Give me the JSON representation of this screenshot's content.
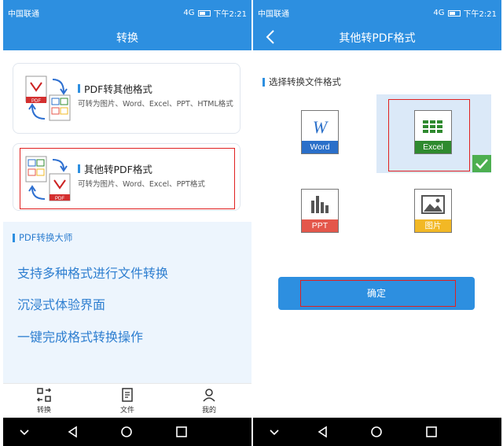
{
  "status": {
    "carrier": "中国联通",
    "network": "4G",
    "time": "下午2:21"
  },
  "convert": {
    "title": "转换",
    "cards": [
      {
        "title": "PDF转其他格式",
        "desc": "可转为图片、Word、Excel、PPT、HTML格式"
      },
      {
        "title": "其他转PDF格式",
        "desc": "可转为图片、Word、Excel、PPT格式"
      }
    ],
    "promo": {
      "label": "PDF转换大师",
      "lines": [
        "支持多种格式进行文件转换",
        "沉浸式体验界面",
        "一键完成格式转换操作"
      ]
    },
    "tabs": [
      "转换",
      "文件",
      "我的"
    ],
    "icon_labels": {
      "pdf": "PDF"
    }
  },
  "other_to_pdf": {
    "title": "其他转PDF格式",
    "section_label": "选择转换文件格式",
    "formats": [
      {
        "label": "Word",
        "icon": "word-icon",
        "selected": false
      },
      {
        "label": "Excel",
        "icon": "excel-icon",
        "selected": true
      },
      {
        "label": "PPT",
        "icon": "ppt-icon",
        "selected": false
      },
      {
        "label": "图片",
        "icon": "image-icon",
        "selected": false
      }
    ],
    "confirm": "确定"
  },
  "colors": {
    "primary": "#2d8fe0",
    "highlight": "#e02020",
    "selected_bg": "#dbe9f8",
    "check": "#4caf50"
  }
}
